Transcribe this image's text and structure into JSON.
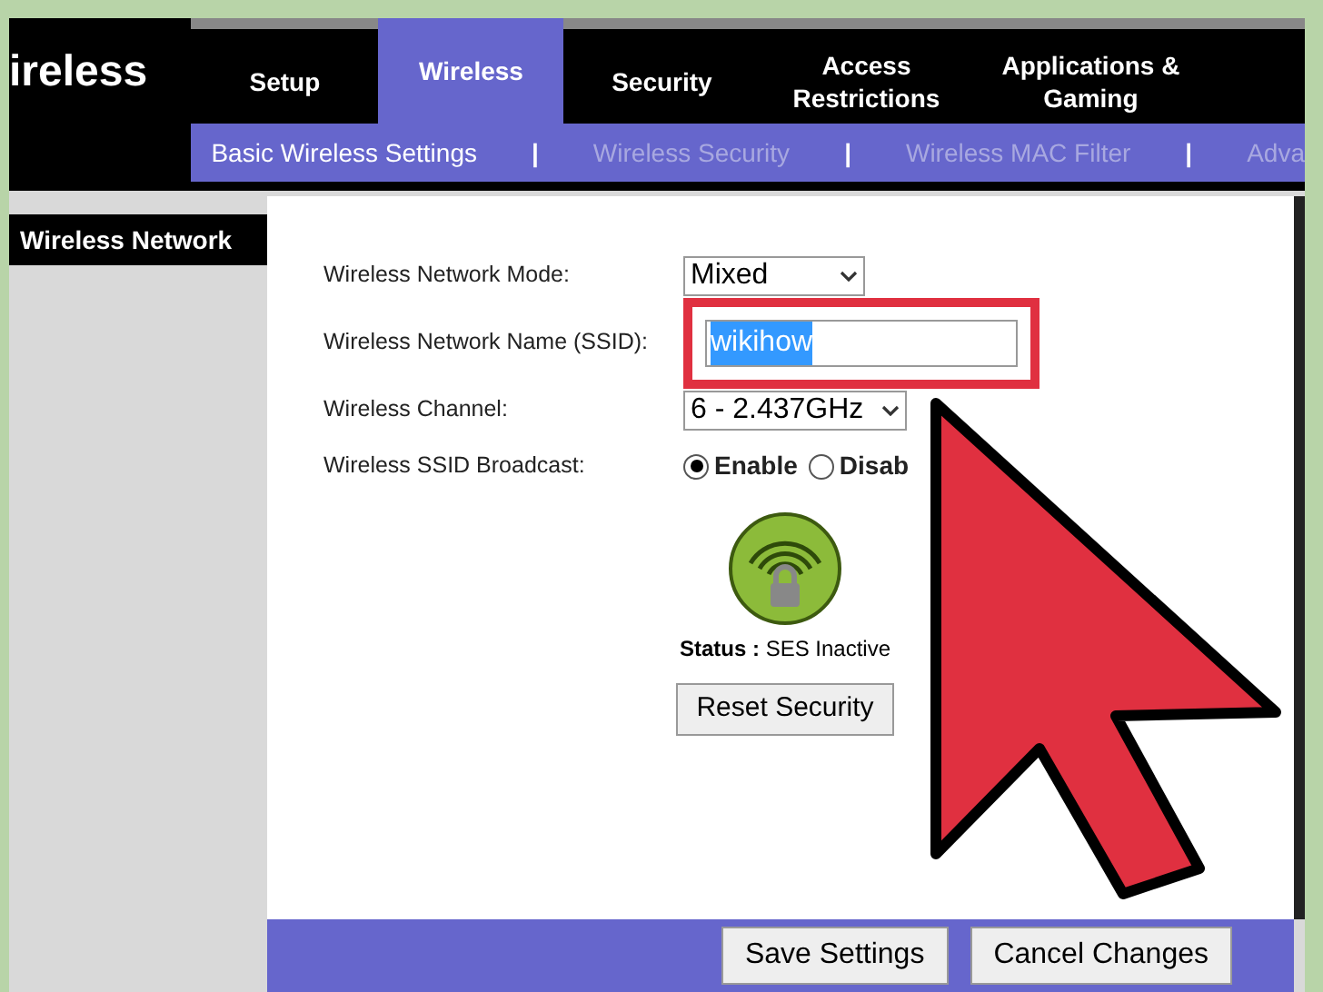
{
  "header": {
    "title": "ireless"
  },
  "tabs": [
    {
      "label": "Setup",
      "selected": false
    },
    {
      "label": "Wireless",
      "selected": true
    },
    {
      "label": "Security",
      "selected": false
    },
    {
      "label": "Access Restrictions",
      "selected": false
    },
    {
      "label": "Applications & Gaming",
      "selected": false
    }
  ],
  "subnav": [
    {
      "label": "Basic Wireless Settings",
      "selected": true,
      "separator": "|"
    },
    {
      "label": "Wireless Security",
      "selected": false,
      "separator": "|"
    },
    {
      "label": "Wireless MAC Filter",
      "selected": false,
      "separator": "|"
    },
    {
      "label": "Adva",
      "selected": false
    }
  ],
  "sidebar": {
    "heading": "Wireless Network"
  },
  "form": [
    {
      "kind": "select",
      "label": "Wireless Network Mode:",
      "value": "Mixed"
    },
    {
      "kind": "input",
      "label": "Wireless Network Name (SSID):",
      "value": "wikihow",
      "highlighted": true
    },
    {
      "kind": "select",
      "label": "Wireless Channel:",
      "value": "6 - 2.437GHz"
    },
    {
      "kind": "radio",
      "label": "Wireless SSID Broadcast:",
      "options": [
        {
          "label": "Enable",
          "selected": true
        },
        {
          "label": "Disab",
          "selected": false
        }
      ]
    }
  ],
  "ses": {
    "status": "**Status :** SES Inactive",
    "button": "Reset Security"
  },
  "footer": {
    "buttons": [
      "Save Settings",
      "Cancel Changes"
    ]
  }
}
